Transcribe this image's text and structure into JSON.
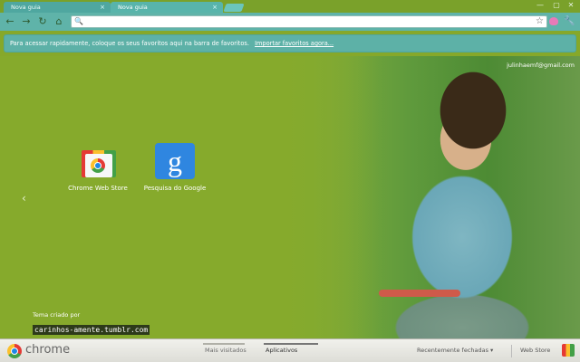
{
  "tabs": [
    {
      "label": "Nova guia",
      "close": "×"
    },
    {
      "label": "Nova guia",
      "close": "×"
    }
  ],
  "window_controls": {
    "minimize": "—",
    "restore": "▢",
    "close": "✕"
  },
  "toolbar": {
    "back_icon": "arrow-left-icon",
    "forward_icon": "arrow-right-icon",
    "reload_icon": "reload-icon",
    "home_icon": "home-icon",
    "omnibox_value": "",
    "search_glyph": "🔍",
    "star_glyph": "☆",
    "wrench_glyph": "🔧"
  },
  "infobar": {
    "text": "Para acessar rapidamente, coloque os seus favoritos aqui na barra de favoritos.",
    "link": "Importar favoritos agora..."
  },
  "page": {
    "user_email": "julinhaemf@gmail.com",
    "nav_left": "‹",
    "apps": [
      {
        "label": "Chrome Web Store",
        "icon": "chrome-web-store-icon"
      },
      {
        "label": "Pesquisa do Google",
        "icon": "google-search-icon",
        "glyph": "g"
      }
    ],
    "credit_line1": "Tema criado por",
    "credit_line2": "carinhos-amente.tumblr.com"
  },
  "footer": {
    "brand": "chrome",
    "tabs": [
      {
        "label": "Mais visitados",
        "selected": false
      },
      {
        "label": "Aplicativos",
        "selected": true
      }
    ],
    "recently_closed": "Recentemente fechadas ▾",
    "web_store": "Web Store"
  },
  "colors": {
    "theme_green": "#86aa2c",
    "tab_teal": "#58b4ab",
    "toolbar_teal": "#5fb3a9"
  }
}
